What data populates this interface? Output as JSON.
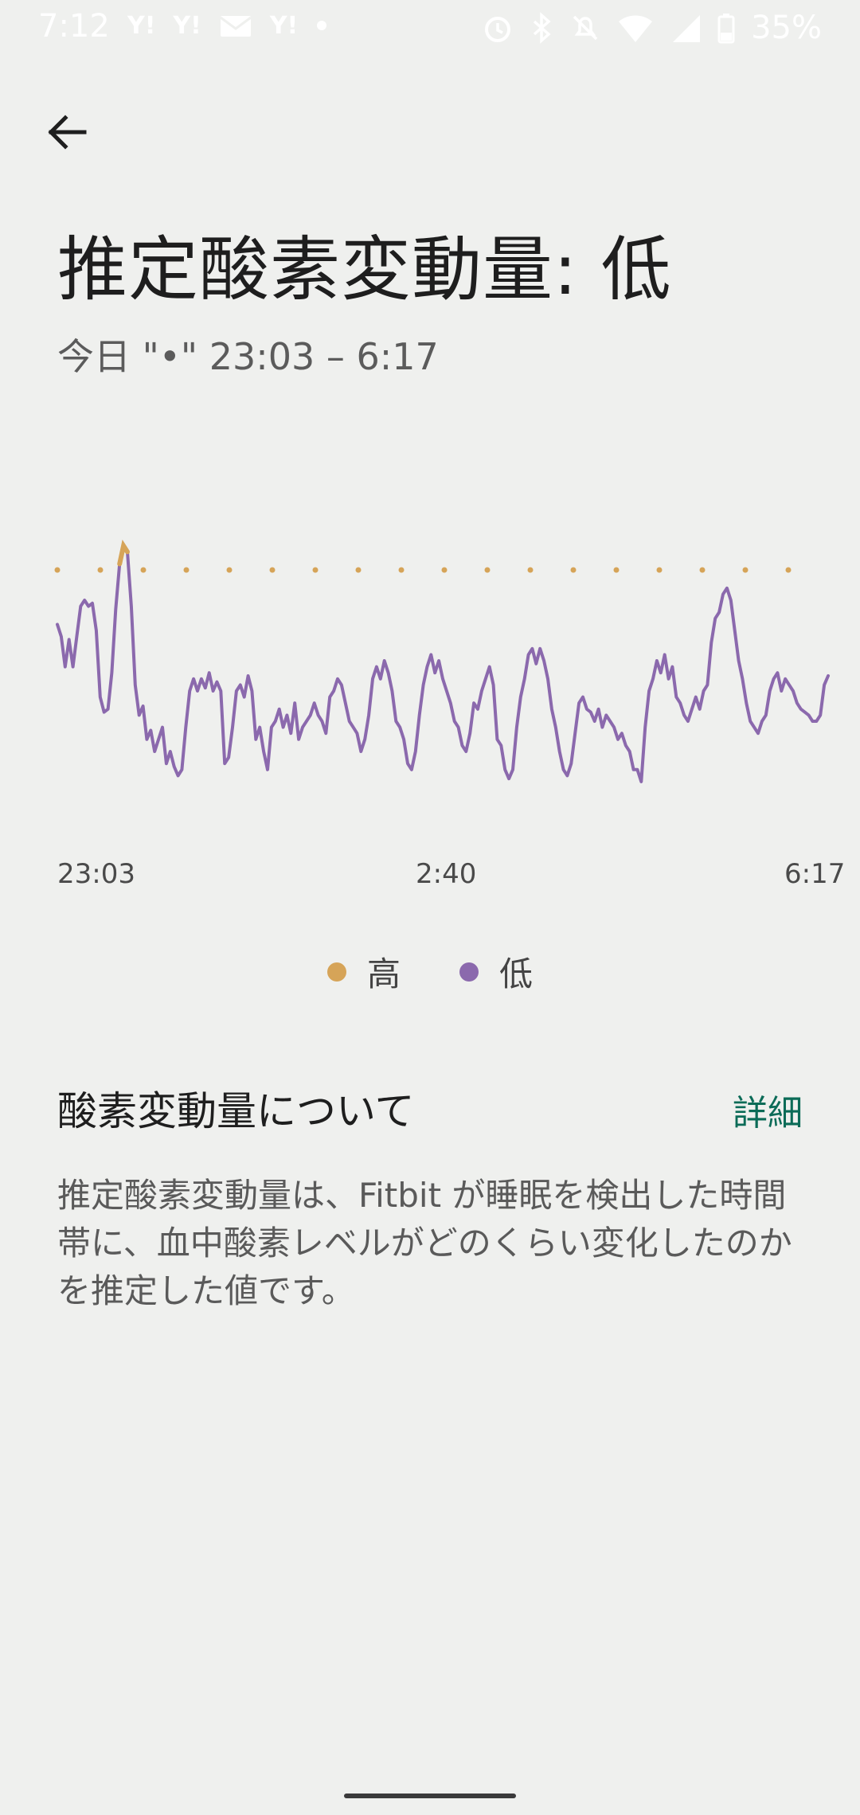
{
  "status_bar": {
    "time": "7:12",
    "left_icons": [
      "Y!",
      "Y!",
      "mail-icon",
      "Y!",
      "dot"
    ],
    "battery_percent": "35%"
  },
  "page": {
    "title": "推定酸素変動量: 低",
    "subtitle": "今日 \"•\" 23:03 – 6:17"
  },
  "chart_data": {
    "type": "line",
    "x_start": "23:03",
    "x_end": "6:17",
    "x_tick_labels": [
      "23:03",
      "2:40",
      "6:17"
    ],
    "y_range": [
      0,
      100
    ],
    "threshold": 80,
    "grid": false,
    "legend_placement": "bottom-center",
    "series": [
      {
        "name": "低",
        "color": "#8b69ad",
        "values": [
          62,
          58,
          48,
          57,
          48,
          58,
          68,
          70,
          68,
          69,
          60,
          38,
          33,
          34,
          46,
          67,
          82,
          88,
          86,
          68,
          42,
          32,
          35,
          24,
          27,
          20,
          24,
          28,
          16,
          20,
          15,
          12,
          14,
          28,
          40,
          44,
          40,
          44,
          41,
          46,
          40,
          43,
          40,
          16,
          18,
          28,
          40,
          42,
          38,
          45,
          40,
          24,
          28,
          20,
          14,
          28,
          30,
          34,
          28,
          32,
          26,
          36,
          24,
          28,
          30,
          32,
          36,
          32,
          30,
          26,
          38,
          40,
          44,
          42,
          36,
          30,
          28,
          26,
          20,
          24,
          32,
          44,
          48,
          44,
          50,
          46,
          40,
          30,
          28,
          24,
          16,
          14,
          20,
          32,
          42,
          48,
          52,
          46,
          50,
          44,
          40,
          36,
          30,
          28,
          22,
          20,
          26,
          36,
          34,
          40,
          44,
          48,
          42,
          24,
          22,
          14,
          11,
          14,
          28,
          38,
          44,
          52,
          54,
          49,
          54,
          50,
          44,
          34,
          28,
          20,
          14,
          12,
          16,
          26,
          36,
          38,
          34,
          33,
          30,
          34,
          28,
          32,
          30,
          28,
          24,
          26,
          22,
          20,
          14,
          14,
          10,
          28,
          40,
          44,
          50,
          46,
          52,
          44,
          48,
          38,
          36,
          32,
          30,
          34,
          38,
          34,
          40,
          42,
          56,
          64,
          66,
          72,
          74,
          70,
          60,
          50,
          44,
          36,
          30,
          28,
          26,
          30,
          32,
          40,
          44,
          46,
          40,
          44,
          42,
          40,
          36,
          34,
          33,
          32,
          30,
          30,
          32,
          42,
          45
        ]
      },
      {
        "name": "高",
        "color": "#d6a458",
        "values": []
      }
    ]
  },
  "legend": {
    "high_label": "高",
    "high_color": "#d6a458",
    "low_label": "低",
    "low_color": "#8b69ad"
  },
  "about": {
    "heading": "酸素変動量について",
    "details_label": "詳細",
    "description": "推定酸素変動量は、Fitbit が睡眠を検出した時間帯に、血中酸素レベルがどのくらい変化したのかを推定した値です。"
  }
}
